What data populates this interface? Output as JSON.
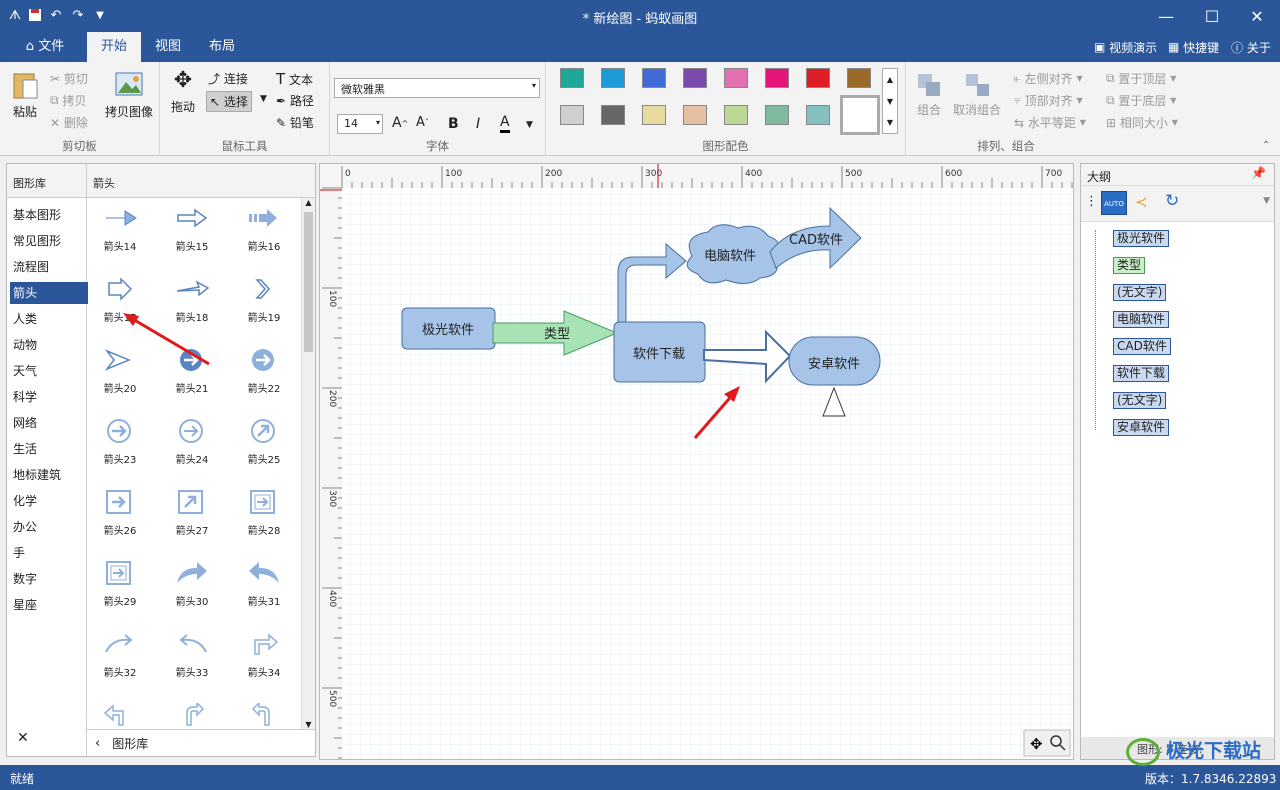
{
  "window": {
    "title": "* 新绘图 - 蚂蚁画图"
  },
  "menu": {
    "tabs": [
      "文件",
      "开始",
      "视图",
      "布局"
    ],
    "right": {
      "video": "视频演示",
      "shortcut": "快捷键",
      "about": "关于"
    }
  },
  "ribbon": {
    "clipboard": {
      "paste": "粘贴",
      "cut": "剪切",
      "copy": "拷贝",
      "delete": "删除",
      "copy_image": "拷贝图像",
      "label": "剪切板"
    },
    "mouse": {
      "drag": "拖动",
      "connect": "连接",
      "select": "选择",
      "text": "文本",
      "path": "路径",
      "pencil": "铅笔",
      "label": "鼠标工具"
    },
    "font": {
      "family": "微软雅黑",
      "size": "14",
      "bold": "B",
      "italic": "I",
      "color": "A",
      "label": "字体"
    },
    "colors": {
      "label": "图形配色",
      "row1": [
        "#1fa89a",
        "#1e9bd7",
        "#3f6ad8",
        "#7b4bab",
        "#e070b0",
        "#e6157c",
        "#e01e26",
        "#9a6a2a"
      ],
      "row2": [
        "#cfcfcf",
        "#666666",
        "#e6dca0",
        "#e5c0a0",
        "#bcd796",
        "#7fba9e",
        "#84c0c0",
        "#a5c4ea"
      ]
    },
    "arrange": {
      "group": "组合",
      "ungroup": "取消组合",
      "align_left": "左侧对齐",
      "align_top": "顶部对齐",
      "h_distribute": "水平等距",
      "bring_top": "置于顶层",
      "send_bottom": "置于底层",
      "same_size": "相同大小",
      "label": "排列、组合"
    }
  },
  "library": {
    "header": "图形库",
    "current": "箭头",
    "categories": [
      "基本图形",
      "常见图形",
      "流程图",
      "箭头",
      "人类",
      "动物",
      "天气",
      "科学",
      "网络",
      "生活",
      "地标建筑",
      "化学",
      "办公",
      "手",
      "数字",
      "星座"
    ],
    "shapes": [
      "箭头14",
      "箭头15",
      "箭头16",
      "箭头17",
      "箭头18",
      "箭头19",
      "箭头20",
      "箭头21",
      "箭头22",
      "箭头23",
      "箭头24",
      "箭头25",
      "箭头26",
      "箭头27",
      "箭头28",
      "箭头29",
      "箭头30",
      "箭头31",
      "箭头32",
      "箭头33",
      "箭头34"
    ],
    "close": "✕",
    "back_label": "图形库"
  },
  "ruler": {
    "h": [
      "0",
      "100",
      "200",
      "300",
      "400",
      "500",
      "600",
      "700"
    ],
    "v": [
      "100",
      "200",
      "300",
      "400",
      "500"
    ]
  },
  "diagram": {
    "node_jiguang": "极光软件",
    "label_type": "类型",
    "node_xiazai": "软件下载",
    "node_diannao": "电脑软件",
    "node_cad": "CAD软件",
    "node_anzhuo": "安卓软件"
  },
  "outline": {
    "title": "大纲",
    "items": [
      "极光软件",
      "类型",
      "(无文字)",
      "电脑软件",
      "CAD软件",
      "软件下载",
      "(无文字)",
      "安卓软件"
    ],
    "footer": "图形: 8  连接:"
  },
  "status": {
    "left": "就绪",
    "version": "版本：1.7.8346.22893",
    "watermark": "极光下载站"
  }
}
